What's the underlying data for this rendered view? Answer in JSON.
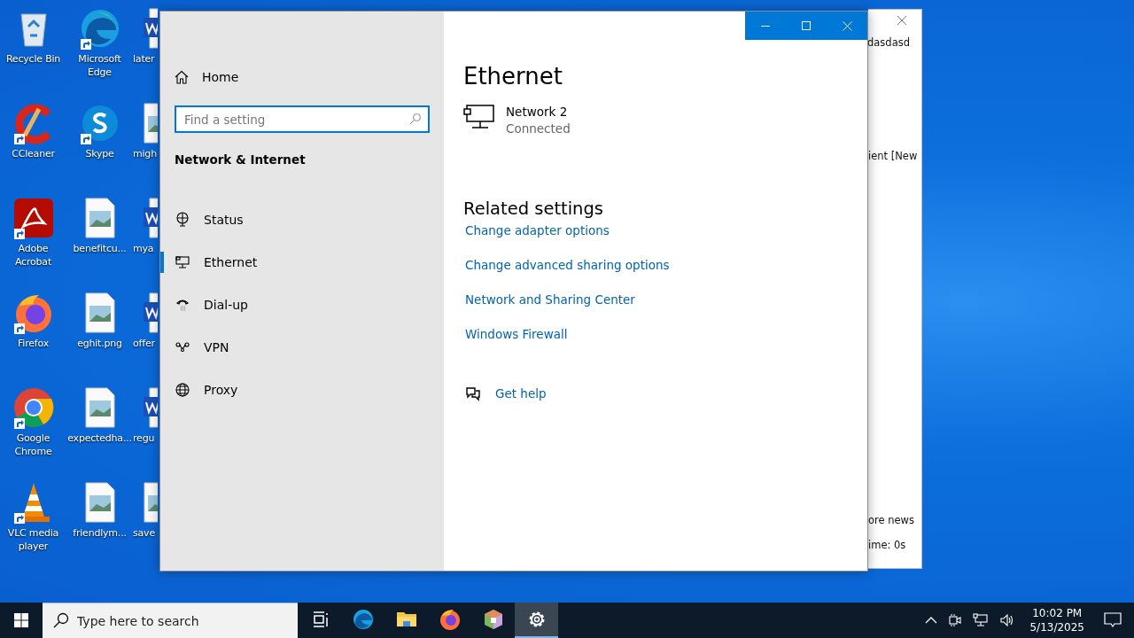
{
  "desktop": {
    "columns": [
      {
        "icons": [
          {
            "label": "Recycle Bin",
            "kind": "recycle",
            "shortcut": false
          },
          {
            "label": "CCleaner",
            "kind": "ccleaner",
            "shortcut": true
          },
          {
            "label": "Adobe Acrobat",
            "kind": "acrobat",
            "shortcut": true
          },
          {
            "label": "Firefox",
            "kind": "firefox",
            "shortcut": true
          },
          {
            "label": "Google Chrome",
            "kind": "chrome",
            "shortcut": true
          },
          {
            "label": "VLC media player",
            "kind": "vlc",
            "shortcut": true
          }
        ]
      },
      {
        "icons": [
          {
            "label": "Microsoft Edge",
            "kind": "edge",
            "shortcut": true
          },
          {
            "label": "Skype",
            "kind": "skype",
            "shortcut": true
          },
          {
            "label": "benefitcu...",
            "kind": "image",
            "shortcut": false
          },
          {
            "label": "eghit.png",
            "kind": "image",
            "shortcut": false
          },
          {
            "label": "expectedha...",
            "kind": "image",
            "shortcut": false
          },
          {
            "label": "friendlym...",
            "kind": "image",
            "shortcut": false
          }
        ]
      },
      {
        "icons": [
          {
            "label": "later",
            "kind": "word",
            "shortcut": false
          },
          {
            "label": "migh",
            "kind": "image",
            "shortcut": false
          },
          {
            "label": "mya",
            "kind": "word",
            "shortcut": false
          },
          {
            "label": "offer",
            "kind": "word",
            "shortcut": false
          },
          {
            "label": "regu",
            "kind": "word",
            "shortcut": false
          },
          {
            "label": "save",
            "kind": "image",
            "shortcut": false
          }
        ]
      }
    ]
  },
  "background_window": {
    "texts": [
      "dasdasd",
      "ient [New",
      "ore news",
      "ime: 0s"
    ]
  },
  "settings": {
    "sidebar": {
      "home": "Home",
      "search": {
        "placeholder": "Find a setting"
      },
      "section": "Network & Internet",
      "items": [
        {
          "label": "Status",
          "kind": "status",
          "selected": false
        },
        {
          "label": "Ethernet",
          "kind": "ethernet",
          "selected": true
        },
        {
          "label": "Dial-up",
          "kind": "dialup",
          "selected": false
        },
        {
          "label": "VPN",
          "kind": "vpn",
          "selected": false
        },
        {
          "label": "Proxy",
          "kind": "proxy",
          "selected": false
        }
      ]
    },
    "content": {
      "title": "Ethernet",
      "network": {
        "name": "Network 2",
        "status": "Connected"
      },
      "related_heading": "Related settings",
      "links": [
        "Change adapter options",
        "Change advanced sharing options",
        "Network and Sharing Center",
        "Windows Firewall"
      ],
      "help": "Get help"
    }
  },
  "taskbar": {
    "search": {
      "placeholder": "Type here to search"
    },
    "apps": [
      {
        "kind": "taskview",
        "selected": false
      },
      {
        "kind": "edge",
        "selected": false
      },
      {
        "kind": "folder",
        "selected": false
      },
      {
        "kind": "firefox",
        "selected": false
      },
      {
        "kind": "box",
        "selected": false
      },
      {
        "kind": "settings",
        "selected": true
      }
    ],
    "time": "10:02 PM",
    "date": "5/13/2025"
  }
}
